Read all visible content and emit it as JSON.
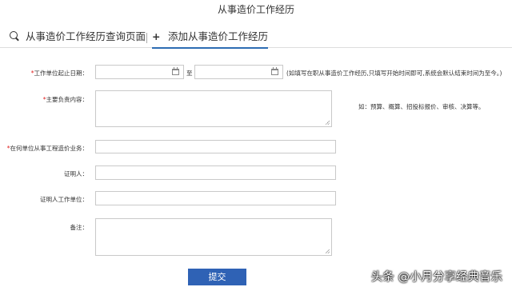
{
  "page": {
    "title": "从事造价工作经历"
  },
  "tabs": [
    {
      "label": "从事造价工作经历查询页面",
      "icon": "search-icon",
      "active": false
    },
    {
      "label": "添加从事造价工作经历",
      "icon": "plus-icon",
      "active": true
    }
  ],
  "form": {
    "work_period": {
      "required_mark": "*",
      "label": "工作单位起止日期：",
      "start_value": "",
      "separator": "至",
      "end_value": "",
      "hint": "(如填写在职从事造价工作经历,只填写开始时间即可,系统会默认结束时间为至今。)"
    },
    "responsibilities": {
      "required_mark": "*",
      "label": "主要负责内容：",
      "value": "",
      "hint": "如：预算、概算、招投标报价、审核、决算等。"
    },
    "business": {
      "required_mark": "*",
      "label": "在何单位从事工程造价业务：",
      "value": ""
    },
    "witness": {
      "label": "证明人：",
      "value": ""
    },
    "witness_employer": {
      "label": "证明人工作单位：",
      "value": ""
    },
    "remarks": {
      "label": "备注：",
      "value": ""
    },
    "submit_label": "提交"
  },
  "watermark": "头条 @小月分享经典音乐"
}
